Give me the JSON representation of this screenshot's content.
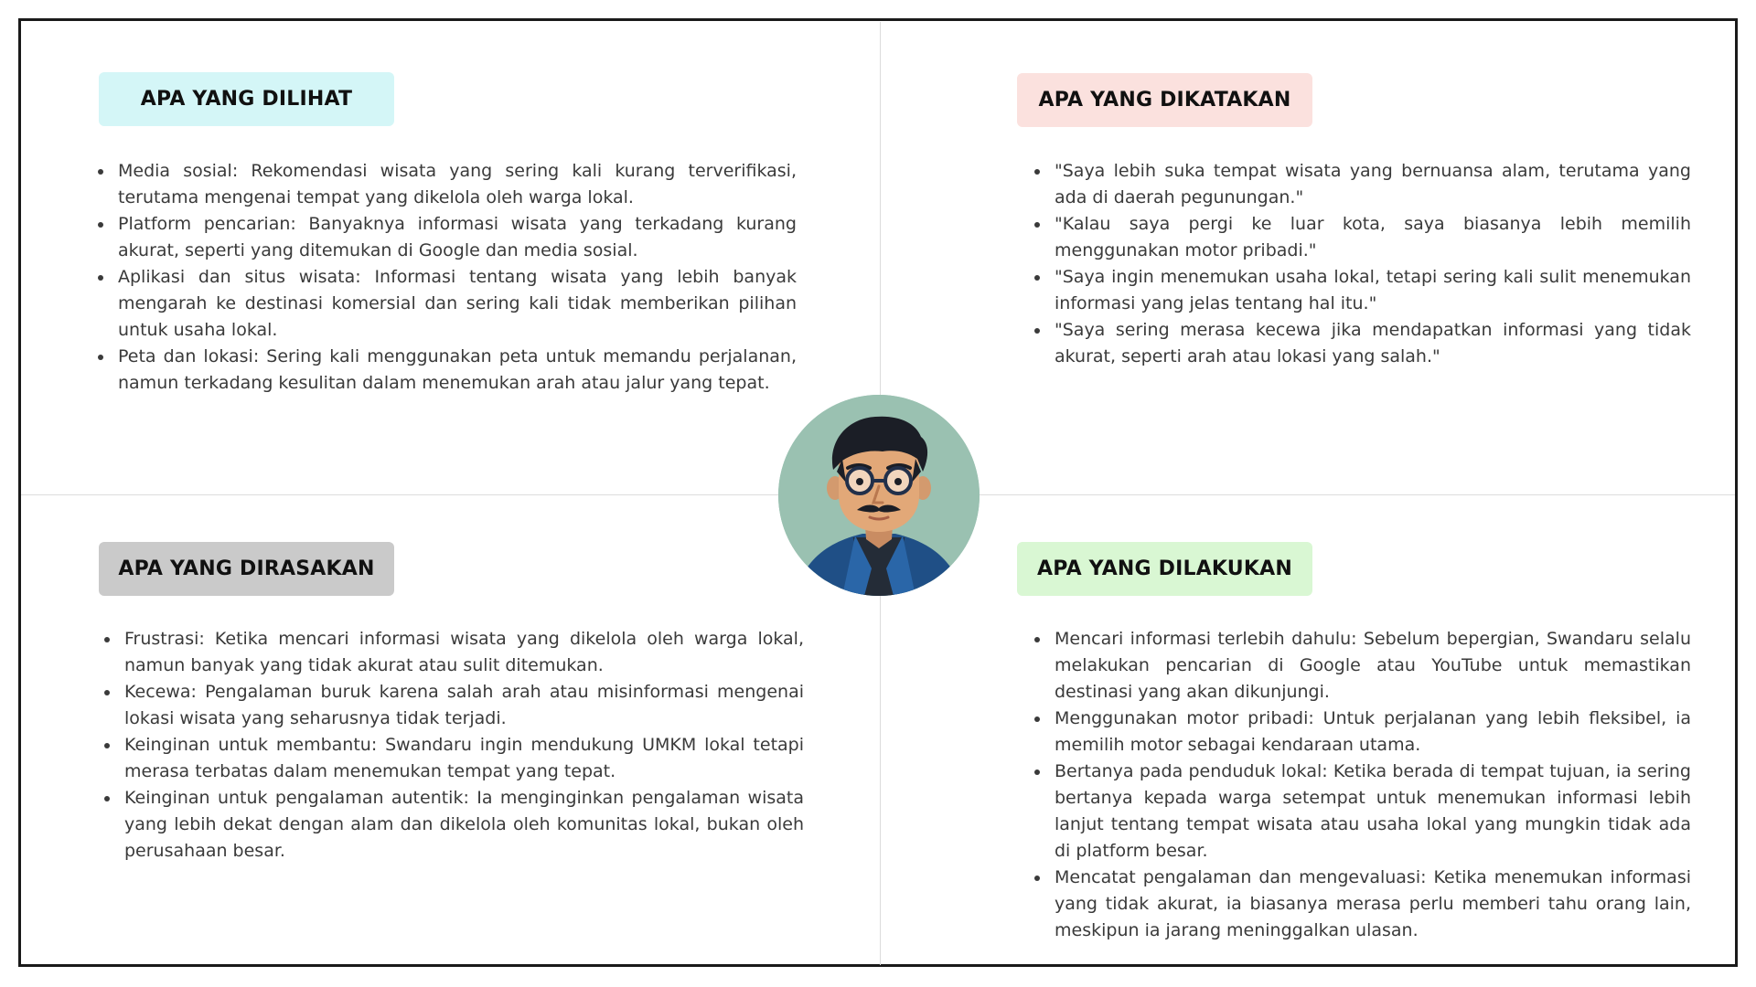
{
  "quadrants": {
    "sees": {
      "title": "APA YANG DILIHAT",
      "color": "#d4f6f7",
      "items": [
        "Media sosial: Rekomendasi wisata yang sering kali kurang terverifikasi, terutama mengenai tempat yang dikelola oleh warga lokal.",
        "Platform pencarian: Banyaknya informasi wisata yang terkadang kurang akurat, seperti yang ditemukan di Google dan media sosial.",
        "Aplikasi dan situs wisata: Informasi tentang wisata yang lebih banyak mengarah ke destinasi komersial dan sering kali tidak memberikan pilihan untuk usaha lokal.",
        "Peta dan lokasi: Sering kali menggunakan peta untuk memandu perjalanan, namun terkadang kesulitan dalam menemukan arah atau jalur yang tepat."
      ]
    },
    "says": {
      "title": "APA YANG DIKATAKAN",
      "color": "#fbe1de",
      "items": [
        "\"Saya lebih suka tempat wisata yang bernuansa alam, terutama yang ada di daerah pegunungan.\"",
        "\"Kalau saya pergi ke luar kota, saya biasanya lebih memilih menggunakan motor pribadi.\"",
        "\"Saya ingin menemukan usaha lokal, tetapi sering kali sulit menemukan informasi yang jelas tentang hal itu.\"",
        "\"Saya sering merasa kecewa jika mendapatkan informasi yang tidak akurat, seperti arah atau lokasi yang salah.\""
      ]
    },
    "feels": {
      "title": "APA YANG DIRASAKAN",
      "color": "#cacaca",
      "items": [
        "Frustrasi: Ketika mencari informasi wisata yang dikelola oleh warga lokal, namun banyak yang tidak akurat atau sulit ditemukan.",
        "Kecewa: Pengalaman buruk karena salah arah atau misinformasi mengenai lokasi wisata yang seharusnya tidak terjadi.",
        "Keinginan untuk membantu: Swandaru ingin mendukung UMKM lokal tetapi merasa terbatas dalam menemukan tempat yang tepat.",
        "Keinginan untuk pengalaman autentik: Ia menginginkan pengalaman wisata yang lebih dekat dengan alam dan dikelola oleh komunitas lokal, bukan oleh perusahaan besar."
      ]
    },
    "does": {
      "title": "APA YANG DILAKUKAN",
      "color": "#d9f7d3",
      "items": [
        "Mencari informasi terlebih dahulu: Sebelum bepergian, Swandaru selalu melakukan pencarian di Google atau YouTube untuk memastikan destinasi yang akan dikunjungi.",
        "Menggunakan motor pribadi: Untuk perjalanan yang lebih fleksibel, ia memilih motor sebagai kendaraan utama.",
        "Bertanya pada penduduk lokal: Ketika berada di tempat tujuan, ia sering bertanya kepada warga setempat untuk menemukan informasi lebih lanjut tentang tempat wisata atau usaha lokal yang mungkin tidak ada di platform besar.",
        "Mencatat pengalaman dan mengevaluasi: Ketika menemukan informasi yang tidak akurat, ia biasanya merasa perlu memberi tahu orang lain, meskipun ia jarang meninggalkan ulasan."
      ]
    }
  },
  "avatar": {
    "icon": "persona-avatar-icon",
    "background_color": "#9ac1b1"
  }
}
